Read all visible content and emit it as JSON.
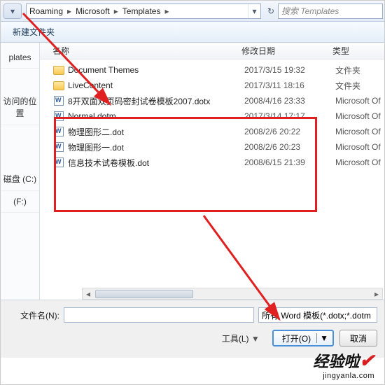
{
  "breadcrumb": {
    "p1": "Roaming",
    "p2": "Microsoft",
    "p3": "Templates"
  },
  "search": {
    "placeholder": "搜索 Templates"
  },
  "toolbar": {
    "newfolder": "新建文件夹"
  },
  "sidebar": {
    "item1": "plates",
    "item2": "访问的位置",
    "item3": "磁盘 (C:)",
    "item4": "(F:)"
  },
  "headers": {
    "name": "名称",
    "date": "修改日期",
    "type": "类型"
  },
  "files": [
    {
      "icon": "folder",
      "name": "Document Themes",
      "date": "2017/3/15 19:32",
      "type": "文件夹"
    },
    {
      "icon": "folder",
      "name": "LiveContent",
      "date": "2017/3/11 18:16",
      "type": "文件夹"
    },
    {
      "icon": "word",
      "name": "8开双面双页码密封试卷模板2007.dotx",
      "date": "2008/4/16 23:33",
      "type": "Microsoft Of"
    },
    {
      "icon": "word",
      "name": "Normal.dotm",
      "date": "2017/3/14 17:17",
      "type": "Microsoft Of"
    },
    {
      "icon": "word",
      "name": "物理图形二.dot",
      "date": "2008/2/6 20:22",
      "type": "Microsoft Of"
    },
    {
      "icon": "word",
      "name": "物理图形一.dot",
      "date": "2008/2/6 20:23",
      "type": "Microsoft Of"
    },
    {
      "icon": "word",
      "name": "信息技术试卷模板.dot",
      "date": "2008/6/15 21:39",
      "type": "Microsoft Of"
    }
  ],
  "bottom": {
    "filename_lbl": "文件名(N):",
    "filter": "所有 Word 模板(*.dotx;*.dotm",
    "tools": "工具(L)",
    "open": "打开(O)",
    "cancel": "取消"
  },
  "watermark": {
    "big": "经验啦",
    "small": "jingyanla.com"
  }
}
